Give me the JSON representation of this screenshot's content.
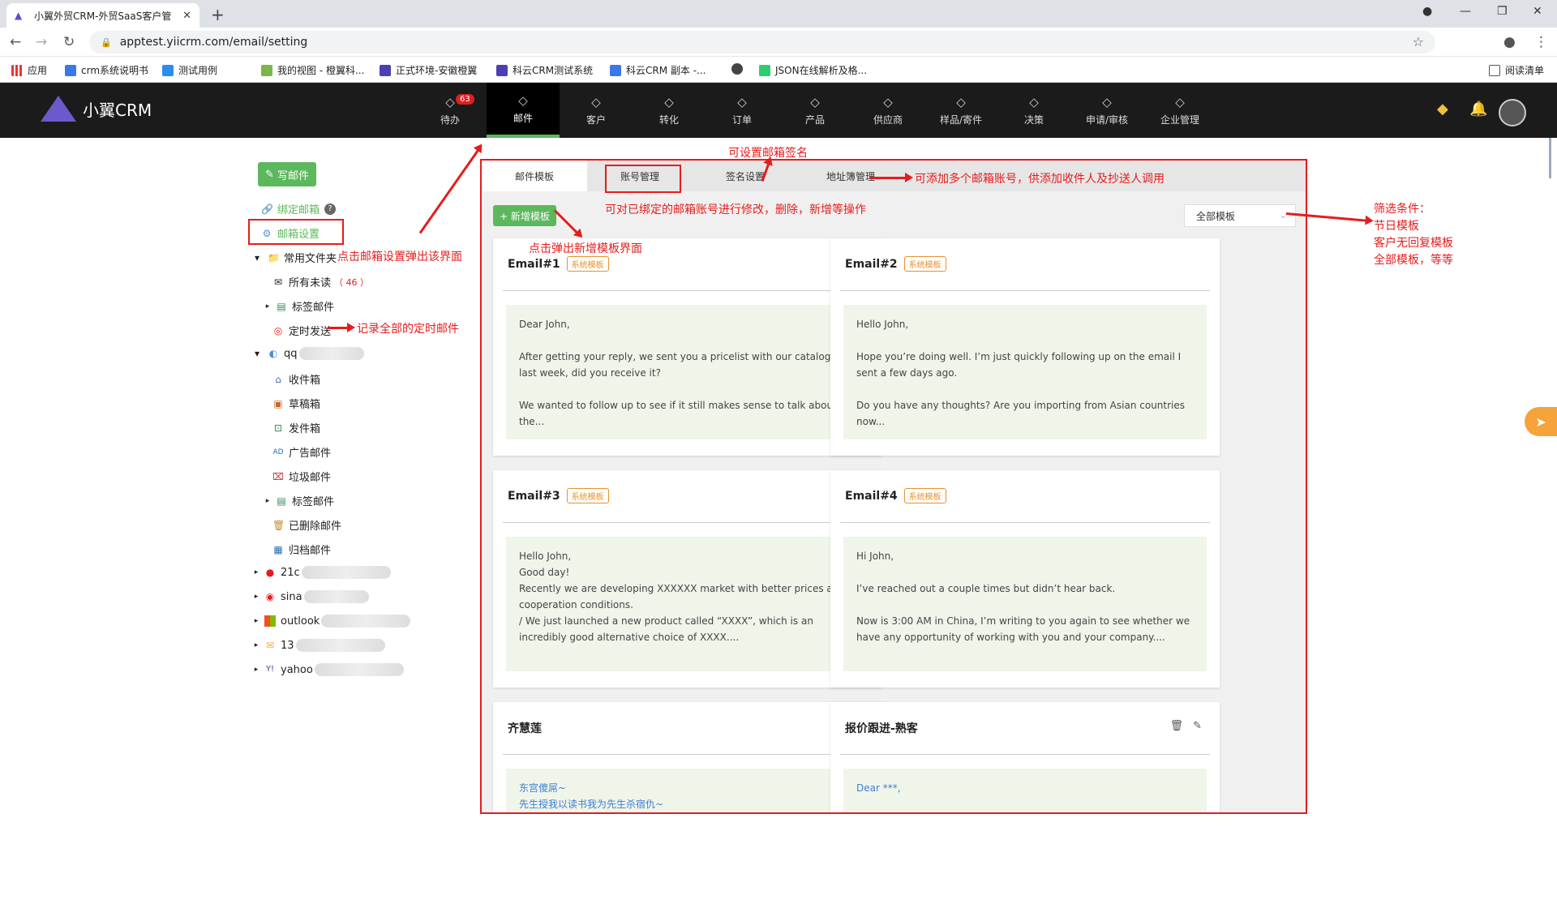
{
  "browser": {
    "tab_title": "小翼外贸CRM-外贸SaaS客户管",
    "url": "apptest.yiicrm.com/email/setting",
    "bookmarks": [
      "应用",
      "crm系统说明书",
      "测试用例",
      "我的视图 - 橙翼科...",
      "正式环境-安徽橙翼",
      "科云CRM测试系统",
      "科云CRM 副本 -...",
      "",
      "JSON在线解析及格..."
    ],
    "reading_list": "阅读清单"
  },
  "app": {
    "logo": "小翼CRM",
    "nav": [
      {
        "label": "待办",
        "icon": "lightning-icon",
        "badge": "63"
      },
      {
        "label": "邮件",
        "icon": "mail-icon",
        "active": true
      },
      {
        "label": "客户",
        "icon": "user-icon"
      },
      {
        "label": "转化",
        "icon": "convert-icon"
      },
      {
        "label": "订单",
        "icon": "order-icon"
      },
      {
        "label": "产品",
        "icon": "product-icon"
      },
      {
        "label": "供应商",
        "icon": "supplier-icon"
      },
      {
        "label": "样品/寄件",
        "icon": "sample-icon"
      },
      {
        "label": "决策",
        "icon": "decision-icon"
      },
      {
        "label": "申请/审核",
        "icon": "approval-icon"
      },
      {
        "label": "企业管理",
        "icon": "enterprise-icon"
      }
    ]
  },
  "sidebar": {
    "compose": "写邮件",
    "bind": "绑定邮箱",
    "settings": "邮箱设置",
    "common_folder": "常用文件夹",
    "all_unread": "所有未读",
    "unread_count": "（ 46 ）",
    "tagged": "标签邮件",
    "scheduled": "定时发送",
    "qq_account": "qq",
    "inbox": "收件箱",
    "drafts": "草稿箱",
    "sent": "发件箱",
    "ads": "广告邮件",
    "spam": "垃圾邮件",
    "tagged2": "标签邮件",
    "deleted": "已删除邮件",
    "archived": "归档邮件",
    "accounts": [
      "21c",
      "sina",
      "outlook",
      "13",
      "yahoo"
    ]
  },
  "tabs": [
    "邮件模板",
    "账号管理",
    "签名设置",
    "地址簿管理"
  ],
  "add_template": "+ 新增模板",
  "filter": "全部模板",
  "cards": [
    {
      "title": "Email#1",
      "tag": "系统模板",
      "lines": [
        "Dear John,",
        "",
        "After getting your reply, we sent you a pricelist with our catalogue last week, did you receive it?",
        "",
        "We wanted to follow up to see if it still makes sense to talk about the..."
      ]
    },
    {
      "title": "Email#2",
      "tag": "系统模板",
      "lines": [
        "Hello John,",
        "",
        "Hope you’re doing well. I’m just quickly following up on the email I sent a few days ago.",
        "",
        "Do you have any thoughts? Are you importing from Asian countries now..."
      ]
    },
    {
      "title": "Email#3",
      "tag": "系统模板",
      "lines": [
        "Hello John,",
        "Good day!",
        "Recently we are developing XXXXXX market with better prices and cooperation conditions.",
        "/ We just launched a new product called “XXXX”, which is an incredibly good alternative choice of XXXX...."
      ]
    },
    {
      "title": "Email#4",
      "tag": "系统模板",
      "lines": [
        "Hi John,",
        "",
        "I’ve reached out a couple times but didn’t hear back.",
        "",
        "Now is 3:00 AM in China, I’m writing to you again to see whether we have any opportunity of working with you and your company...."
      ]
    },
    {
      "title": "齐慧莲",
      "tag": "",
      "lines": [
        "东宫傻屌~",
        "先生授我以读书我为先生杀宿仇~"
      ]
    },
    {
      "title": "报价跟进-熟客",
      "tag": "",
      "lines": [
        "Dear ***,"
      ]
    }
  ],
  "annotations": {
    "signature": "可设置邮箱签名",
    "addressbook": "可添加多个邮箱账号，供添加收件人及抄送人调用",
    "account_ops": "可对已绑定的邮箱账号进行修改，删除，新增等操作",
    "add_popup": "点击弹出新增模板界面",
    "settings_popup": "点击邮箱设置弹出该界面",
    "scheduled_note": "记录全部的定时邮件",
    "filter_title": "筛选条件：",
    "filter_1": "节日模板",
    "filter_2": "客户无回复模板",
    "filter_3": "全部模板，等等"
  }
}
